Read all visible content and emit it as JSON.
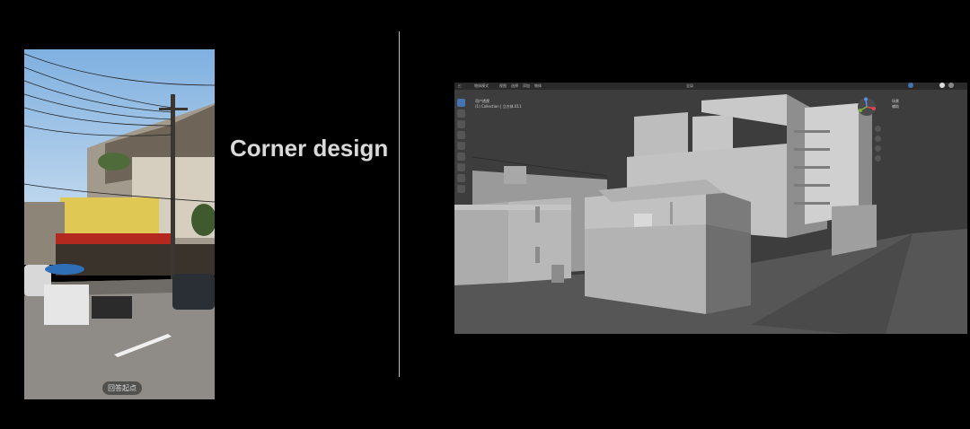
{
  "title": "Corner design",
  "photo": {
    "badge_label": "回答起点"
  },
  "viewport": {
    "header": {
      "left_label": "物体模式",
      "menus": [
        "视图",
        "选择",
        "添加",
        "物体"
      ],
      "transform_label": "全局"
    },
    "info": {
      "line1": "用户透视",
      "line2": "(1) Collection | 立方体.011"
    },
    "gizmo_labels": [
      "场景",
      "辅助"
    ],
    "colors": {
      "background": "#3d3d3d",
      "building": "#b4b4b4",
      "ground": "#565656",
      "active_tool": "#4772b3"
    }
  }
}
